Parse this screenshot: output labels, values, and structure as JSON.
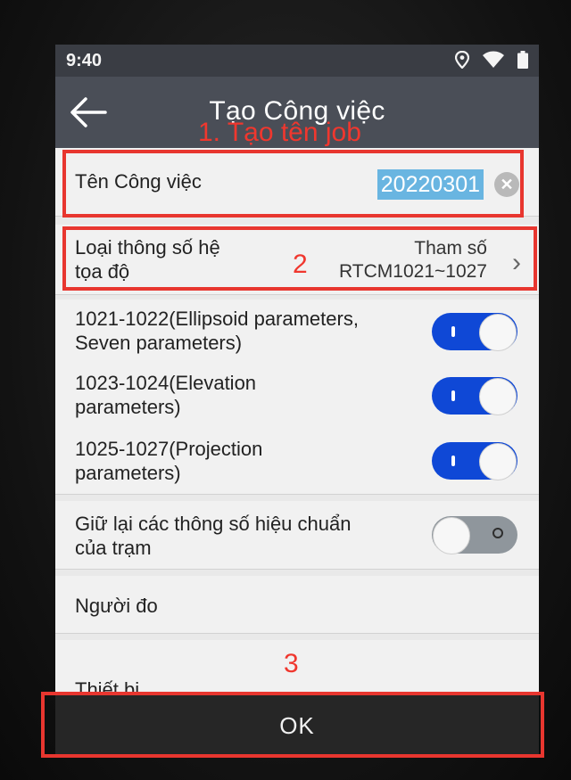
{
  "status_bar": {
    "time": "9:40",
    "icons": [
      "location-icon",
      "wifi-icon",
      "battery-icon"
    ]
  },
  "app_bar": {
    "title": "Tạo Công việc",
    "back_icon": "back-arrow-icon"
  },
  "form": {
    "job_name": {
      "label": "Tên Công việc",
      "value": "20220301",
      "clear_icon": "clear-icon"
    },
    "coord_system": {
      "label_line1": "Loại thông số hệ",
      "label_line2": "tọa độ",
      "value_line1": "Tham số",
      "value_line2": "RTCM1021~1027",
      "chevron_icon": "chevron-right-icon"
    },
    "toggles": [
      {
        "line1": "1021-1022(Ellipsoid parameters,",
        "line2": "Seven parameters)",
        "on": true
      },
      {
        "line1": "1023-1024(Elevation",
        "line2": "parameters)",
        "on": true
      },
      {
        "line1": "1025-1027(Projection",
        "line2": "parameters)",
        "on": true
      },
      {
        "line1": "Giữ lại các thông số hiệu chuẩn",
        "line2": "của trạm",
        "on": false
      }
    ],
    "surveyor_label": "Người đo",
    "device_label": "Thiết bị"
  },
  "ok_button": {
    "label": "OK"
  },
  "annotations": {
    "step1": "1. Tạo tên job",
    "step2": "2",
    "step3": "3",
    "color": "#e8362f"
  },
  "colors": {
    "app_bar": "#4a4e57",
    "toggle_on": "#0f48d6",
    "selection": "#69b5e1"
  }
}
